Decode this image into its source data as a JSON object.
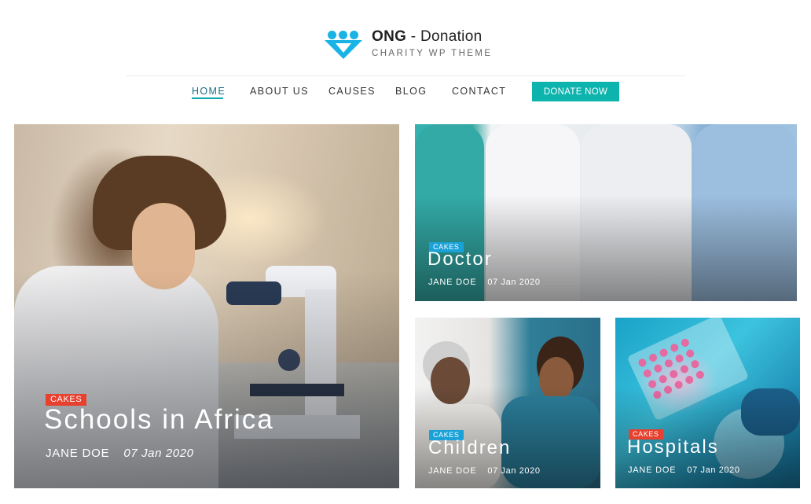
{
  "brand": {
    "name": "ONG",
    "separator": " - ",
    "suffix": "Donation",
    "tagline": "CHARITY WP THEME"
  },
  "nav": {
    "items": [
      {
        "label": "HOME",
        "active": true
      },
      {
        "label": "ABOUT US",
        "active": false
      },
      {
        "label": "CAUSES",
        "active": false
      },
      {
        "label": "BLOG",
        "active": false
      },
      {
        "label": "CONTACT",
        "active": false
      }
    ],
    "donate_label": "DONATE NOW"
  },
  "colors": {
    "accent": "#0db3ad",
    "logo": "#1ab3e6",
    "tag_red": "#e8402f",
    "tag_blue": "#1aa2d8"
  },
  "posts": [
    {
      "category": "CAKES",
      "title": "Schools in Africa",
      "author": "JANE DOE",
      "date": "07 Jan 2020"
    },
    {
      "category": "CAKES",
      "title": "Doctor",
      "author": "JANE DOE",
      "date": "07 Jan 2020"
    },
    {
      "category": "CAKES",
      "title": "Children",
      "author": "JANE DOE",
      "date": "07 Jan 2020"
    },
    {
      "category": "CAKES",
      "title": "Hospitals",
      "author": "JANE DOE",
      "date": "07 Jan 2020"
    }
  ]
}
